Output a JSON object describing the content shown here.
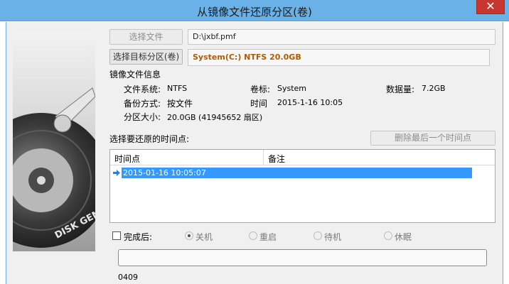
{
  "window": {
    "title": "从镜像文件还原分区(卷)",
    "close_glyph": "✕"
  },
  "source": {
    "button_label": "选择文件",
    "path": "D:\\jxbf.pmf"
  },
  "target": {
    "button_label": "选择目标分区(卷)",
    "value": "System(C:) NTFS 20.0GB",
    "accent": "#b35a00"
  },
  "image_info": {
    "section_title": "镜像文件信息",
    "filesystem_label": "文件系统:",
    "filesystem_value": "NTFS",
    "volume_label": "卷标:",
    "volume_value": "System",
    "datasize_label": "数据量:",
    "datasize_value": "7.2GB",
    "backup_mode_label": "备份方式:",
    "backup_mode_value": "按文件",
    "time_label": "时间",
    "time_value": "2015-1-16 10:05",
    "partition_size_label": "分区大小:",
    "partition_size_value": "20.0GB  (41945652 扇区)"
  },
  "restore_point": {
    "prompt": "选择要还原的时间点:",
    "delete_button": "删除最后一个时间点",
    "columns": [
      "时间点",
      "备注"
    ],
    "rows": [
      {
        "time": "2015-01-16 10:05:07",
        "note": ""
      }
    ]
  },
  "after_complete": {
    "checkbox_label": "完成后:",
    "options": [
      {
        "label": "关机",
        "checked": true
      },
      {
        "label": "重启",
        "checked": false
      },
      {
        "label": "待机",
        "checked": false
      },
      {
        "label": "休眠",
        "checked": false
      }
    ]
  },
  "progress": {
    "percent": 0
  },
  "footer": {
    "code": "0409"
  },
  "sidebar": {
    "brand": "DISK GENIUS"
  },
  "colors": {
    "titlebar": "#6ab1e8",
    "selection": "#3399ff",
    "close": "#c7372f"
  }
}
